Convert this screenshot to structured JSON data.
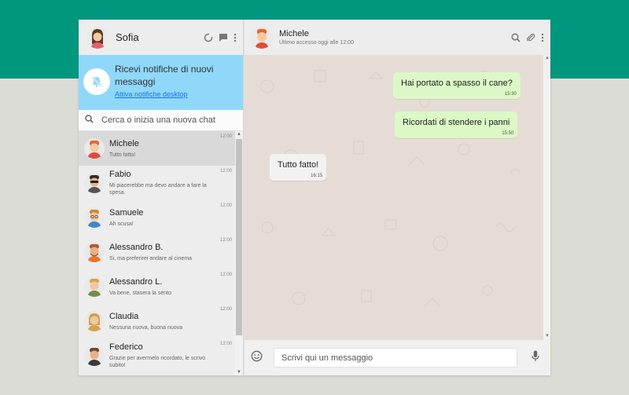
{
  "profile": {
    "name": "Sofia"
  },
  "notification": {
    "title": "Ricevi notifiche di nuovi messaggi",
    "link": "Attiva notifiche desktop"
  },
  "search": {
    "placeholder": "Cerca o inizia una nuova chat"
  },
  "chats": [
    {
      "name": "Michele",
      "preview": "Tutto fatto!",
      "time": "12:00"
    },
    {
      "name": "Fabio",
      "preview": "Mi piacerebbe ma devo andare a fare la spesa.",
      "time": "12:00"
    },
    {
      "name": "Samuele",
      "preview": "Ah scusa!",
      "time": "12:00"
    },
    {
      "name": "Alessandro B.",
      "preview": "Si, ma preferirei andare al cinema",
      "time": "12:00"
    },
    {
      "name": "Alessandro L.",
      "preview": "Va bene, stasera la sento",
      "time": "12:00"
    },
    {
      "name": "Claudia",
      "preview": "Nessuna nuova, buona nuova",
      "time": "12:00"
    },
    {
      "name": "Federico",
      "preview": "Grazie per avermelo ricordato, le scrivo subito!",
      "time": "12:00"
    }
  ],
  "conversation": {
    "contact": "Michele",
    "status": "Ultimo accesso oggi alle 12:00",
    "messages": [
      {
        "text": "Hai portato a spasso il cane?",
        "time": "15:30",
        "direction": "out"
      },
      {
        "text": "Ricordati di stendere i panni",
        "time": "15:50",
        "direction": "out"
      },
      {
        "text": "Tutto fatto!",
        "time": "16:15",
        "direction": "in"
      }
    ]
  },
  "composer": {
    "placeholder": "Scrivi qui un messaggio"
  },
  "icons": {
    "status": "status-ring-icon",
    "new_chat": "chat-bubble-icon",
    "menu": "kebab-menu-icon",
    "bell": "bell-off-icon",
    "search": "search-icon",
    "attach": "paperclip-icon",
    "emoji": "emoji-icon",
    "mic": "microphone-icon"
  },
  "colors": {
    "header_band": "#00977f",
    "notification_bg": "#8fd8fa",
    "outgoing_bubble": "#dcf8c6",
    "incoming_bubble": "#f2f2f2",
    "chat_background": "#e5ddd5",
    "active_chat": "#d9d9d9"
  }
}
